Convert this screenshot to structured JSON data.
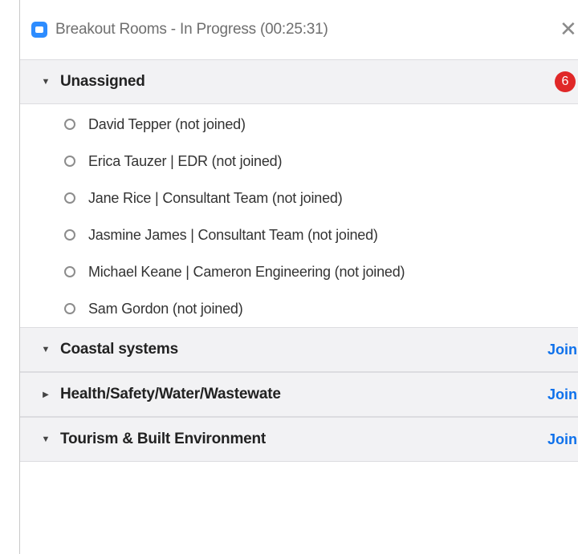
{
  "window": {
    "title": "Breakout Rooms - In Progress (00:25:31)",
    "close_icon": "close-icon"
  },
  "rooms": [
    {
      "name": "Unassigned",
      "expanded": true,
      "badge": "6",
      "participants": [
        "David Tepper (not joined)",
        "Erica Tauzer | EDR (not joined)",
        "Jane Rice | Consultant Team (not joined)",
        "Jasmine James | Consultant Team (not joined)",
        "Michael Keane | Cameron Engineering (not joined)",
        "Sam Gordon (not joined)"
      ]
    },
    {
      "name": "Coastal systems",
      "expanded": true,
      "action": "Join"
    },
    {
      "name": "Health/Safety/Water/Wastewate",
      "expanded": false,
      "action": "Join"
    },
    {
      "name": "Tourism & Built Environment",
      "expanded": true,
      "action": "Join"
    }
  ],
  "colors": {
    "accent": "#0e71eb",
    "badge": "#e02828",
    "zoom_icon": "#2d8cff",
    "header_bg": "#f2f2f4"
  }
}
